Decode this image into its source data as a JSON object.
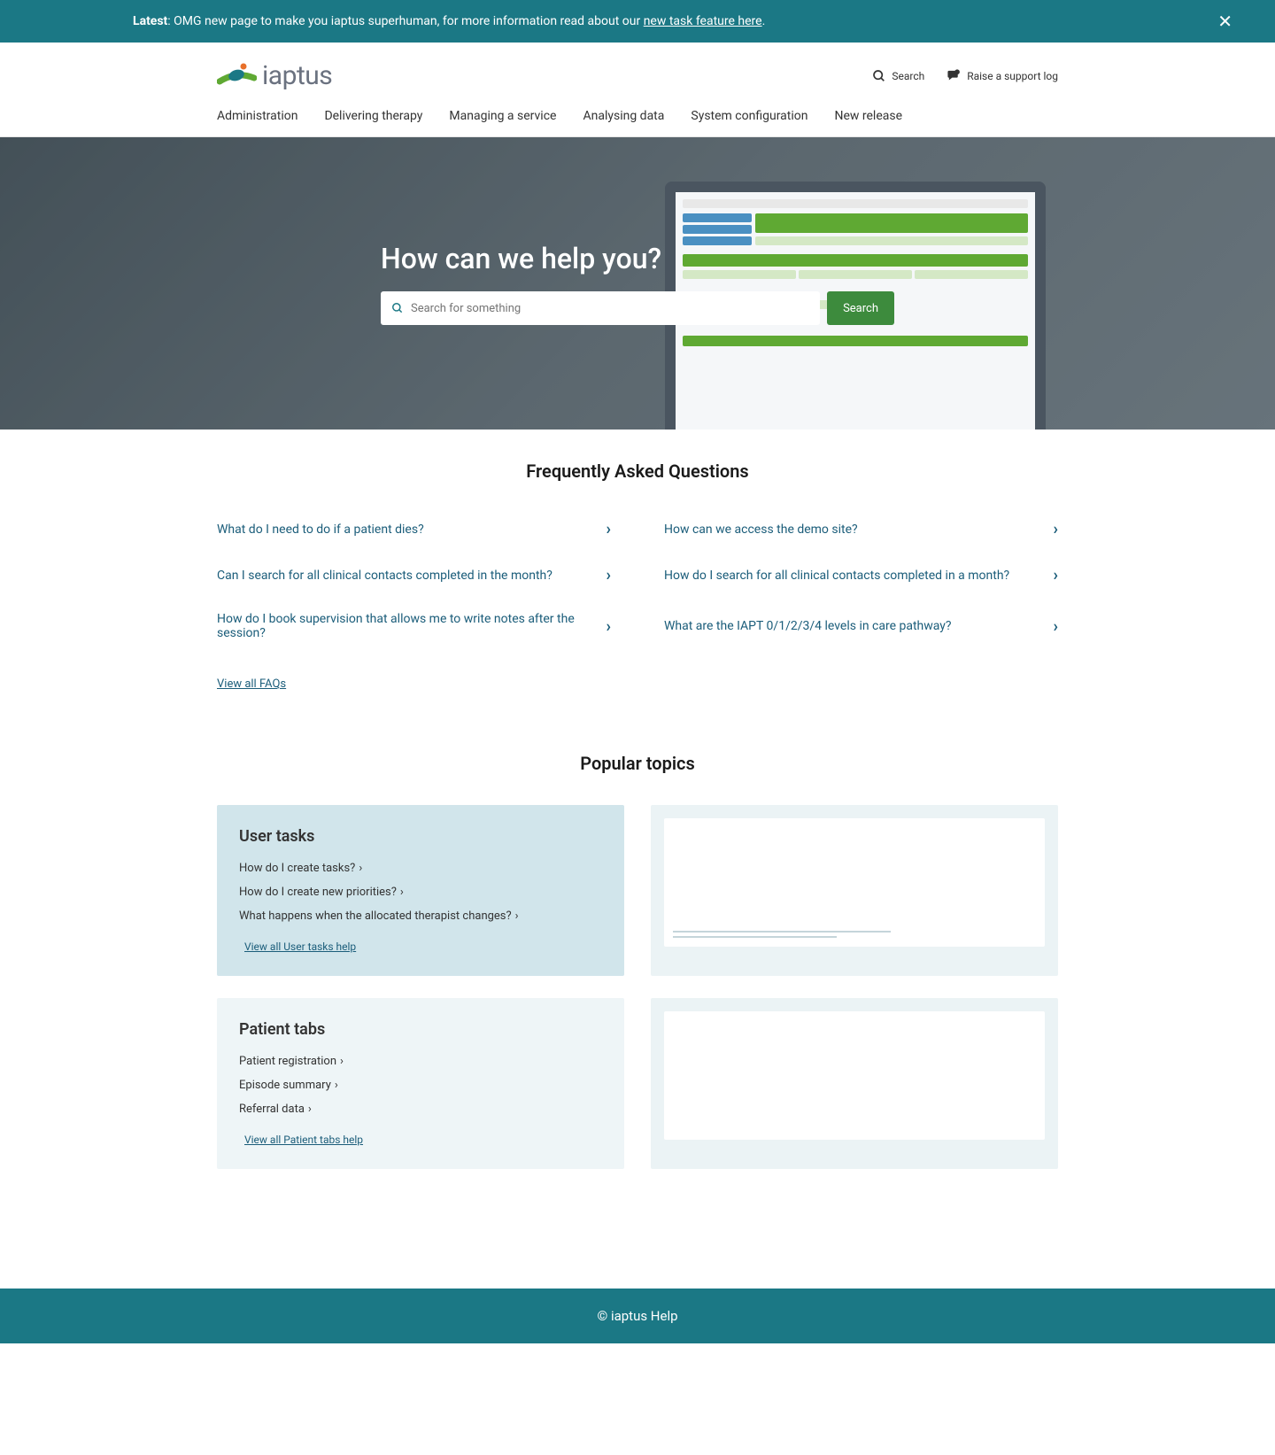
{
  "banner": {
    "prefix": "Latest",
    "text": ": OMG new page to make you iaptus superhuman, for more information read about our ",
    "link": "new task feature here",
    "suffix": "."
  },
  "logo": {
    "text": "iaptus"
  },
  "headerActions": {
    "search": "Search",
    "support": "Raise a support log"
  },
  "nav": [
    "Administration",
    "Delivering therapy",
    "Managing a service",
    "Analysing data",
    "System configuration",
    "New release"
  ],
  "hero": {
    "title": "How can we help you?",
    "placeholder": "Search for something",
    "button": "Search"
  },
  "faq": {
    "title": "Frequently Asked Questions",
    "items": [
      "What do I need to do if a patient dies?",
      "How can we access the demo site?",
      "Can I search for all clinical contacts completed in the month?",
      "How do I search for all clinical contacts completed in a month?",
      "How do I book supervision that allows me to write notes after the session?",
      "What are the IAPT 0/1/2/3/4 levels in care pathway?"
    ],
    "viewAll": "View all FAQs"
  },
  "popular": {
    "title": "Popular topics",
    "topics": [
      {
        "name": "User tasks",
        "links": [
          "How do I create tasks?",
          "How do I create new priorities?",
          "What happens when the allocated therapist changes?"
        ],
        "viewAll": "View all User tasks help"
      },
      {
        "name": "Patient tabs",
        "links": [
          "Patient registration",
          "Episode summary",
          "Referral data"
        ],
        "viewAll": "View all Patient tabs help"
      }
    ]
  },
  "footer": "© iaptus Help"
}
